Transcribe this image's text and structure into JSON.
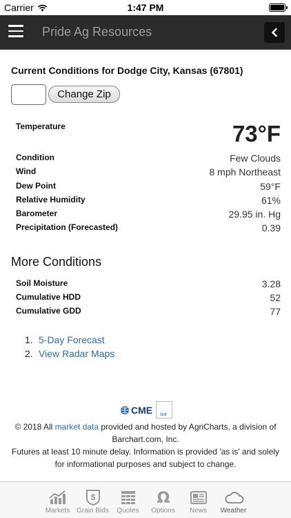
{
  "status": {
    "carrier": "Carrier",
    "time": "1:47 PM"
  },
  "nav": {
    "title": "Pride Ag Resources"
  },
  "conditions": {
    "heading": "Current Conditions for Dodge City, Kansas (67801)",
    "zip_button": "Change Zip",
    "temperature_label": "Temperature",
    "temperature_value": "73°F",
    "rows": [
      {
        "label": "Condition",
        "value": "Few Clouds"
      },
      {
        "label": "Wind",
        "value": "8 mph Northeast"
      },
      {
        "label": "Dew Point",
        "value": "59°F"
      },
      {
        "label": "Relative Humidity",
        "value": "61%"
      },
      {
        "label": "Barometer",
        "value": "29.95 in. Hg"
      },
      {
        "label": "Precipitation (Forecasted)",
        "value": "0.39"
      }
    ]
  },
  "more": {
    "title": "More Conditions",
    "rows": [
      {
        "label": "Soil Moisture",
        "value": "3.28"
      },
      {
        "label": "Cumulative HDD",
        "value": "52"
      },
      {
        "label": "Cumulative GDD",
        "value": "77"
      }
    ]
  },
  "links": [
    {
      "num": "1.",
      "text": "5-Day Forecast"
    },
    {
      "num": "2.",
      "text": "View Radar Maps"
    }
  ],
  "logos": {
    "cme": "CME",
    "ice": "ice"
  },
  "footer": {
    "prefix": "© 2018 All ",
    "link": "market data",
    "suffix": " provided and hosted by AgriCharts, a division of Barchart.com, Inc.",
    "delay": "Futures at least 10 minute delay. Information is provided 'as is' and solely for informational purposes and subject to change."
  },
  "tabs": [
    {
      "label": "Markets",
      "icon": "markets-chart-icon"
    },
    {
      "label": "Grain Bids",
      "icon": "grain-bids-icon"
    },
    {
      "label": "Quotes",
      "icon": "quotes-grid-icon"
    },
    {
      "label": "Options",
      "icon": "options-omega-icon"
    },
    {
      "label": "News",
      "icon": "news-icon"
    },
    {
      "label": "Weather",
      "icon": "weather-cloud-icon"
    }
  ]
}
